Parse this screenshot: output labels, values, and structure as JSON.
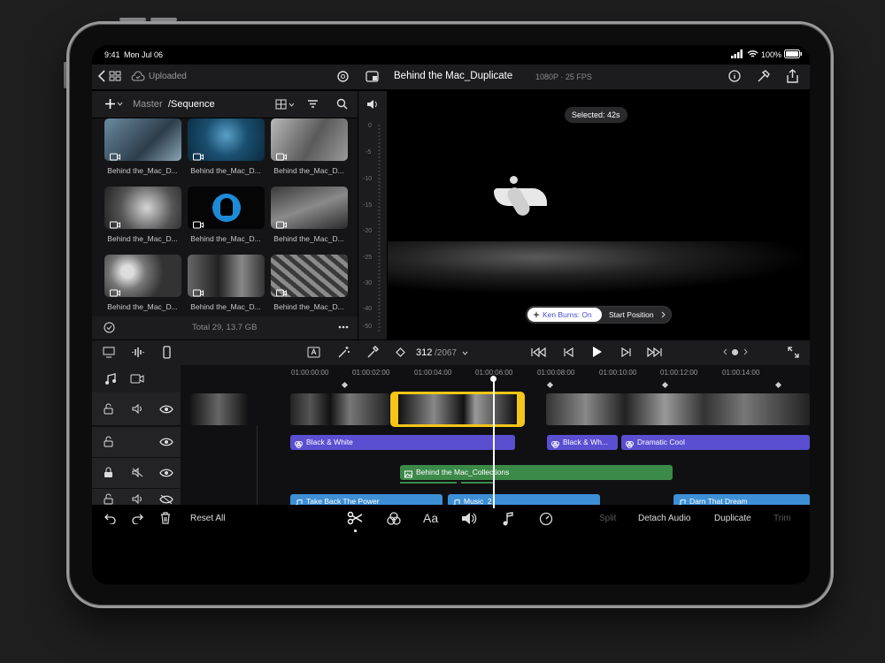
{
  "status": {
    "time": "9:41",
    "date": "Mon Jul 06",
    "battery": "100%"
  },
  "topbar": {
    "upload_status": "Uploaded",
    "project_title": "Behind the Mac_Duplicate",
    "format": "1080P · 25 FPS"
  },
  "media": {
    "breadcrumb_master": "Master",
    "breadcrumb_sequence": "/Sequence",
    "footer": "Total 29, 13.7 GB",
    "thumbs": [
      {
        "label": "Behind the_Mac_D..."
      },
      {
        "label": "Behind the_Mac_D..."
      },
      {
        "label": "Behind the_Mac_D..."
      },
      {
        "label": "Behind the_Mac_D..."
      },
      {
        "label": "Behind the_Mac_D..."
      },
      {
        "label": "Behind the_Mac_D..."
      },
      {
        "label": "Behind the_Mac_D..."
      },
      {
        "label": "Behind the_Mac_D..."
      },
      {
        "label": "Behind the_Mac_D..."
      }
    ]
  },
  "meter": {
    "ticks": [
      "0",
      "-5",
      "-10",
      "-15",
      "-20",
      "-25",
      "-30",
      "-40",
      "-50"
    ]
  },
  "viewer": {
    "selected": "Selected: 42s",
    "ken_burns": "Ken Burns: On",
    "start_position": "Start Position"
  },
  "controls": {
    "frame": "312",
    "total": "/2067"
  },
  "timeline": {
    "ruler": [
      "01:00:00:00",
      "01:00:02:00",
      "01:00:04:00",
      "01:00:06:00",
      "01:00:08:00",
      "01:00:10:00",
      "01:00:12:00",
      "01:00:14:00"
    ],
    "clips": {
      "bw1": "Black & White",
      "bw2": "Black & Wh...",
      "dramatic": "Dramatic Cool",
      "collections": "Behind the Mac_Collections",
      "music1": "Take Back The Power",
      "music2": "Music_2",
      "music3": "Darn That Dream"
    }
  },
  "bottom": {
    "reset": "Reset All",
    "split": "Split",
    "detach": "Detach Audio",
    "duplicate": "Duplicate",
    "trim": "Trim"
  },
  "colors": {
    "accent_yellow": "#f5c518",
    "filter_purple": "#5a4fd1",
    "overlay_green": "#3c8a4a",
    "audio_blue": "#3d8fd6"
  }
}
